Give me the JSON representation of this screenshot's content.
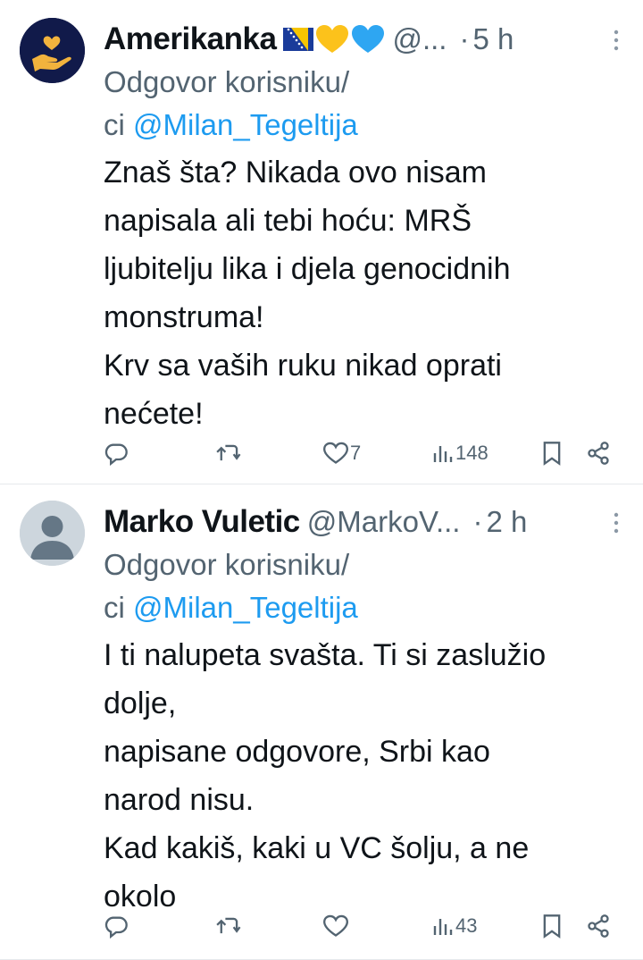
{
  "tweets": [
    {
      "name": "Amerikanka",
      "handle": "@...",
      "dot": "·",
      "time": "5 h",
      "reply_prefix": "Odgovor korisniku/",
      "reply_prefix2": "ci ",
      "mention": "@Milan_Tegeltija",
      "body": "Znaš šta? Nikada ovo nisam\nnapisala ali tebi hoću: MRŠ\nljubitelju lika i djela genocidnih\nmonstruma!\nKrv sa vaših ruku nikad oprati\nnećete!",
      "likes": "7",
      "views": "148",
      "avatar_icon": "hand-heart-icon",
      "name_icons": [
        "bosnia-flag-icon",
        "yellow-heart-icon",
        "blue-heart-icon"
      ]
    },
    {
      "name": "Marko Vuletic",
      "handle": "@MarkoV...",
      "dot": "·",
      "time": "2 h",
      "reply_prefix": "Odgovor korisniku/",
      "reply_prefix2": "ci ",
      "mention": "@Milan_Tegeltija",
      "body": "I ti nalupeta svašta. Ti si  zaslužio\ndolje,\nnapisane odgovore, Srbi kao\nnarod nisu.\nKad kakiš, kaki u VC šolju, a ne\nokolo",
      "likes": "",
      "views": "43",
      "avatar_icon": "default-user-icon"
    }
  ],
  "colors": {
    "accent": "#1d9bf0",
    "muted": "#536471",
    "text": "#0f1419"
  }
}
